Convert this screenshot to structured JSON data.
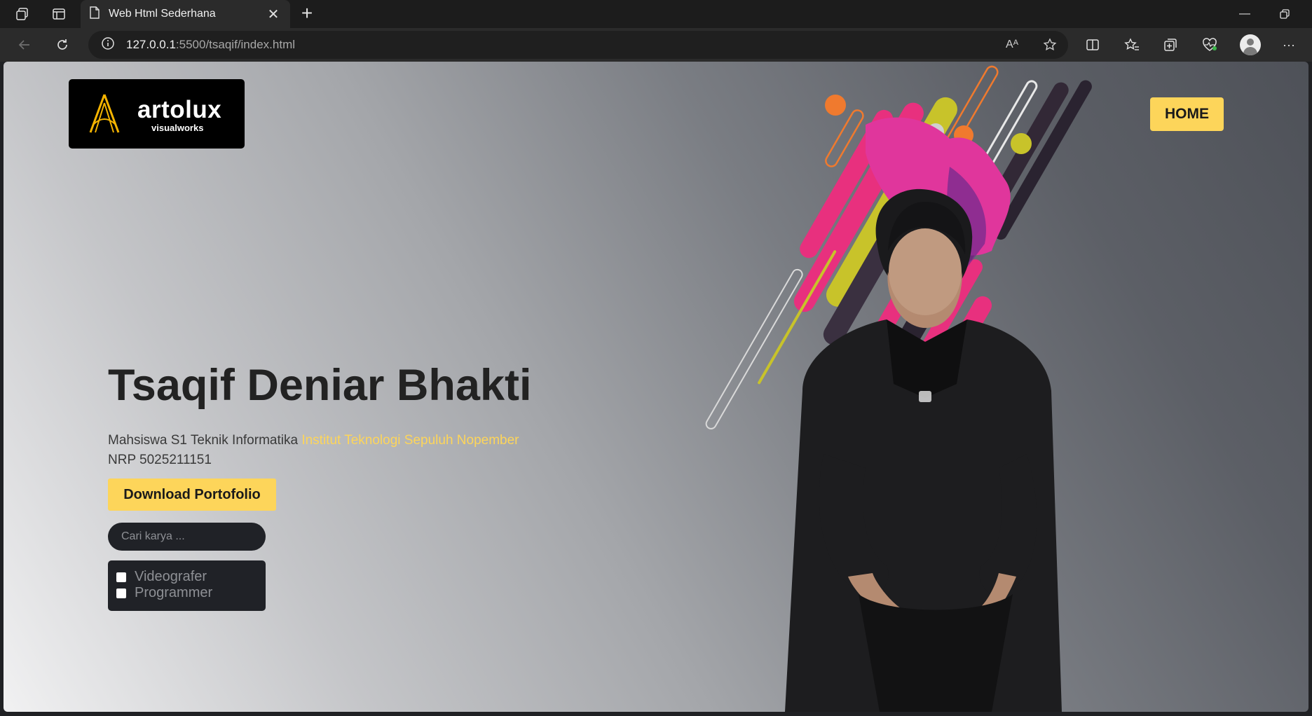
{
  "browser": {
    "tab_title": "Web Html Sederhana",
    "url_host": "127.0.0.1",
    "url_rest": ":5500/tsaqif/index.html",
    "read_aloud_glyph": "Aᴬ"
  },
  "logo": {
    "word": "artolux",
    "sub": "visualworks"
  },
  "nav": {
    "home_label": "HOME"
  },
  "hero": {
    "name": "Tsaqif Deniar Bhakti",
    "desc_prefix": "Mahsiswa S1 Teknik Informatika ",
    "institution": "Institut Teknologi Sepuluh Nopember",
    "nrp": "NRP 5025211151",
    "download_label": "Download Portofolio",
    "search_placeholder": "Cari karya ...",
    "filters": [
      {
        "label": "Videografer",
        "checked": false
      },
      {
        "label": "Programmer",
        "checked": false
      }
    ]
  },
  "colors": {
    "accent": "#fdd55a",
    "dark": "#202227",
    "pink": "#e8307e",
    "yellow_green": "#c8c32a",
    "orange": "#f07a2e"
  }
}
